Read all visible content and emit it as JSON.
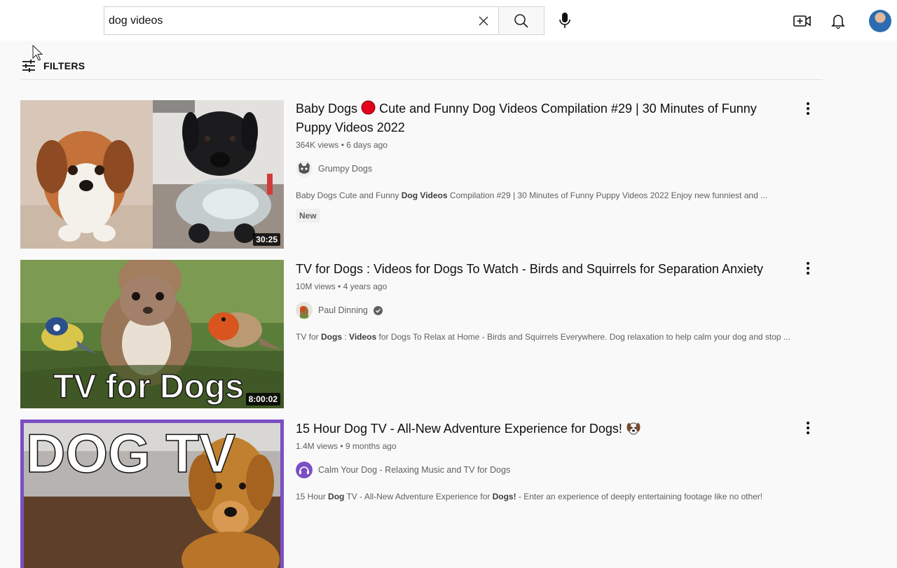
{
  "search": {
    "query": "dog videos"
  },
  "filters": {
    "label": "FILTERS"
  },
  "results": [
    {
      "title_pre": "Baby Dogs ",
      "title_post": " Cute and Funny Dog Videos Compilation #29 | 30 Minutes of Funny Puppy Videos 2022",
      "views": "364K views",
      "age": "6 days ago",
      "channel": "Grumpy Dogs",
      "desc_1": "Baby Dogs Cute and Funny ",
      "desc_2": "Dog Videos",
      "desc_3": " Compilation #29 | 30 Minutes of Funny Puppy Videos 2022 Enjoy new funniest and ...",
      "badge": "New",
      "duration": "30:25"
    },
    {
      "title": "TV for Dogs : Videos for Dogs To Watch - Birds and Squirrels for Separation Anxiety",
      "views": "10M views",
      "age": "4 years ago",
      "channel": "Paul Dinning",
      "desc_1": "TV for ",
      "desc_2": "Dogs",
      "desc_3": " : ",
      "desc_4": "Videos",
      "desc_5": " for Dogs To Relax at Home - Birds and Squirrels Everywhere. Dog relaxation to help calm your dog and stop ...",
      "duration": "8:00:02",
      "thumb_text": "TV for Dogs"
    },
    {
      "title": "15 Hour Dog TV - All-New Adventure Experience for Dogs! ",
      "views": "1.4M views",
      "age": "9 months ago",
      "channel": "Calm Your Dog - Relaxing Music and TV for Dogs",
      "desc_1": "15 Hour ",
      "desc_2": "Dog",
      "desc_3": " TV - All-New Adventure Experience for ",
      "desc_4": "Dogs!",
      "desc_5": " - Enter an experience of deeply entertaining footage like no other!",
      "thumb_text": "DOG TV"
    }
  ],
  "icons": [
    "clear-icon",
    "search-icon",
    "mic-icon",
    "create-video-icon",
    "bell-icon",
    "filters-icon",
    "kebab-icon",
    "verified-icon",
    "live-dot-icon",
    "dog-face-emoji-icon"
  ],
  "colors": {
    "live_dot": "#e4001b",
    "thumb3_border": "#7b4fc4"
  }
}
